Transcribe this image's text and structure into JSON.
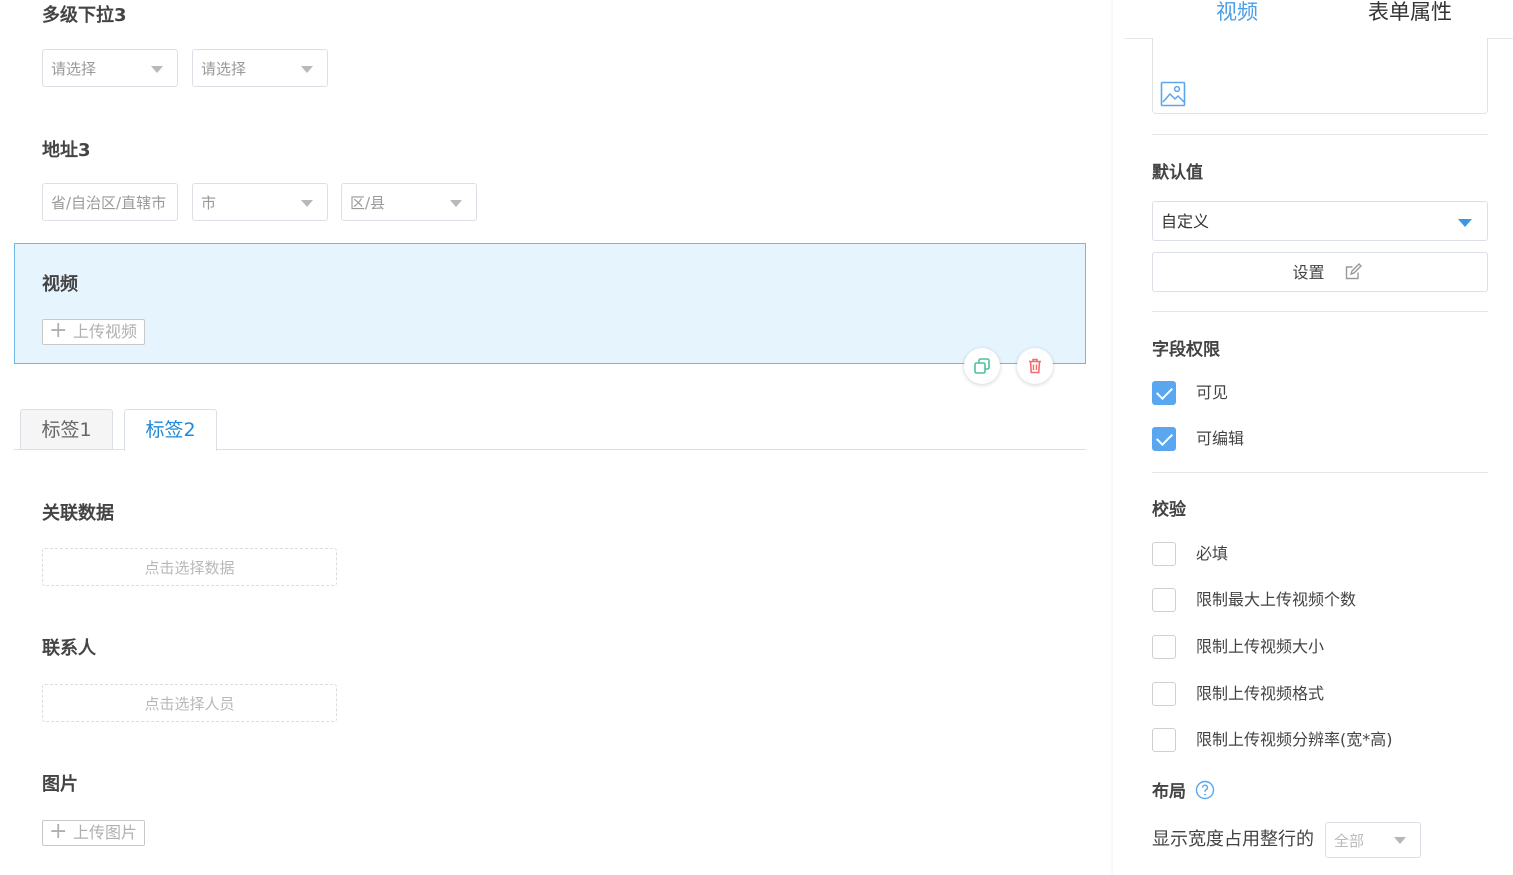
{
  "canvas": {
    "cascader": {
      "title": "多级下拉3",
      "placeholders": [
        "请选择",
        "请选择"
      ]
    },
    "address": {
      "title": "地址3",
      "placeholders": [
        "省/自治区/直辖市",
        "市",
        "区/县"
      ]
    },
    "video": {
      "title": "视频",
      "upload_label": "上传视频"
    },
    "tabs": [
      {
        "label": "标签1"
      },
      {
        "label": "标签2"
      }
    ],
    "related": {
      "title": "关联数据",
      "placeholder": "点击选择数据"
    },
    "contact": {
      "title": "联系人",
      "placeholder": "点击选择人员"
    },
    "image": {
      "title": "图片",
      "upload_label": "上传图片"
    }
  },
  "panel": {
    "tabs": [
      {
        "label": "视频"
      },
      {
        "label": "表单属性"
      }
    ],
    "default_value": {
      "title": "默认值",
      "selected": "自定义",
      "setting_label": "设置"
    },
    "permissions": {
      "title": "字段权限",
      "items": [
        {
          "label": "可见",
          "checked": true
        },
        {
          "label": "可编辑",
          "checked": true
        }
      ]
    },
    "validation": {
      "title": "校验",
      "items": [
        {
          "label": "必填",
          "checked": false
        },
        {
          "label": "限制最大上传视频个数",
          "checked": false
        },
        {
          "label": "限制上传视频大小",
          "checked": false
        },
        {
          "label": "限制上传视频格式",
          "checked": false
        },
        {
          "label": "限制上传视频分辨率(宽*高)",
          "checked": false
        }
      ]
    },
    "layout": {
      "title": "布局",
      "width_label": "显示宽度占用整行的",
      "width_value": "全部"
    }
  },
  "colors": {
    "accent": "#4a9fe6",
    "selected_bg": "#e6f4fd",
    "delete": "#f56c6c",
    "copy": "#4cc29a"
  },
  "icons": [
    "chevron-down-icon",
    "copy-icon",
    "trash-icon",
    "image-icon",
    "edit-icon",
    "help-circle-icon",
    "plus-icon",
    "check-icon"
  ]
}
